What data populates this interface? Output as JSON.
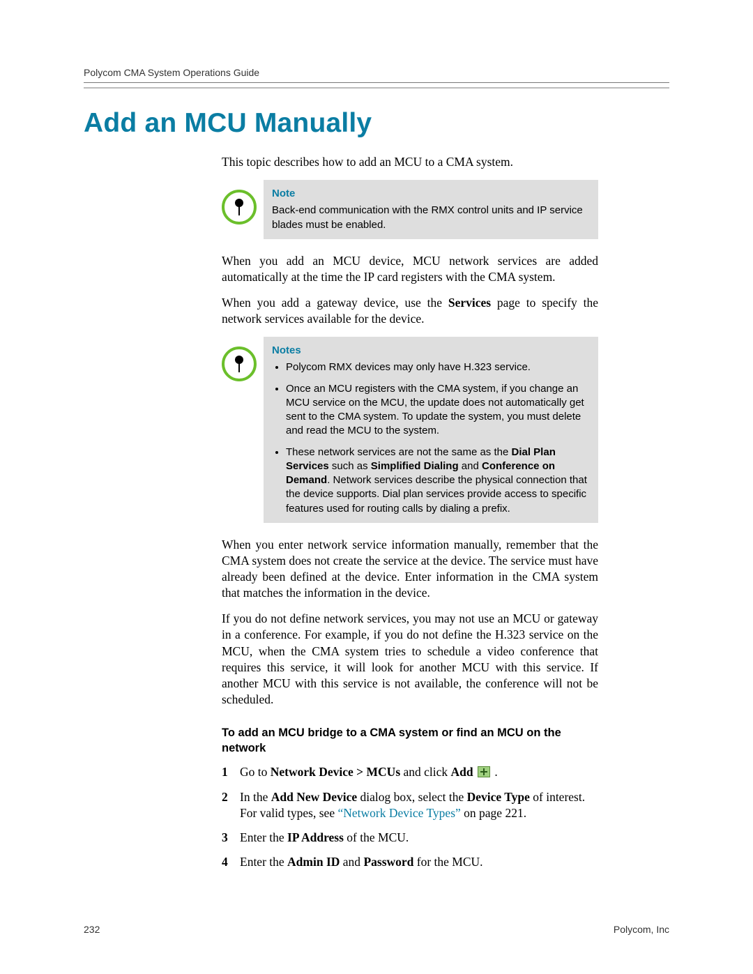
{
  "header": {
    "running_title": "Polycom CMA System Operations Guide"
  },
  "title": "Add an MCU Manually",
  "intro": "This topic describes how to add an MCU to a CMA system.",
  "note1": {
    "label": "Note",
    "text": "Back-end communication with the RMX control units and IP service blades must be enabled."
  },
  "p1": "When you add an MCU device, MCU network services are added automatically at the time the IP card registers with the CMA system.",
  "p2_pre": "When you add a gateway device, use the ",
  "p2_bold": "Services",
  "p2_post": " page to specify the network services available for the device.",
  "notes_label": "Notes",
  "notes": {
    "b1": "Polycom RMX devices may only have H.323 service.",
    "b2": "Once an MCU registers with the CMA system, if you change an MCU service on the MCU, the update does not automatically get sent to the CMA system. To update the system, you must delete and read the MCU to the system.",
    "b3_pre": "These network services are not the same as the ",
    "b3_b1": "Dial Plan Services",
    "b3_mid1": " such as ",
    "b3_b2": "Simplified Dialing",
    "b3_mid2": " and ",
    "b3_b3": "Conference on Demand",
    "b3_post": ". Network services describe the physical connection that the device supports. Dial plan services provide access to specific features used for routing calls by dialing a prefix."
  },
  "p3": "When you enter network service information manually, remember that the CMA system does not create the service at the device. The service must have already been defined at the device. Enter information in the CMA system that matches the information in the device.",
  "p4": "If you do not define network services, you may not use an MCU or gateway in a conference. For example, if you do not define the H.323 service on the MCU, when the CMA system tries to schedule a video conference that requires this service, it will look for another MCU with this service. If another MCU with this service is not available, the conference will not be scheduled.",
  "proc_title": "To add an MCU bridge to a CMA system or find an MCU on the network",
  "steps": {
    "s1_pre": "Go to ",
    "s1_b1": "Network Device > MCUs",
    "s1_mid": " and click ",
    "s1_b2": "Add",
    "s1_post": " .",
    "s2_pre": "In the ",
    "s2_b1": "Add New Device",
    "s2_mid1": " dialog box, select the ",
    "s2_b2": "Device Type",
    "s2_mid2": " of interest. For valid types, see ",
    "s2_link": "“Network Device Types”",
    "s2_post": " on page 221.",
    "s3_pre": "Enter the ",
    "s3_b1": "IP Address",
    "s3_post": " of the MCU.",
    "s4_pre": "Enter the ",
    "s4_b1": "Admin ID",
    "s4_mid": " and ",
    "s4_b2": "Password",
    "s4_post": " for the MCU."
  },
  "footer": {
    "page_number": "232",
    "company": "Polycom, Inc"
  }
}
